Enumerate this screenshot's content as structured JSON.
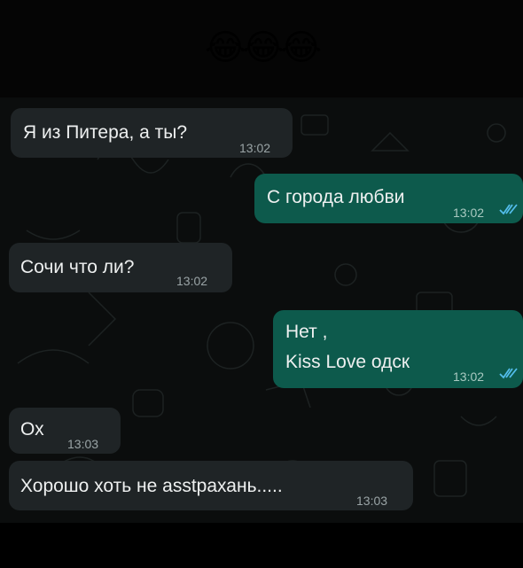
{
  "header": {
    "emojis": "😂😂😂"
  },
  "messages": [
    {
      "direction": "incoming",
      "text": "Я из Питера,  а ты?",
      "time": "13:02"
    },
    {
      "direction": "outgoing",
      "text": "С города любви",
      "time": "13:02",
      "status": "read",
      "status_icon": "double-check-icon"
    },
    {
      "direction": "incoming",
      "text": "Сочи что ли?",
      "time": "13:02"
    },
    {
      "direction": "outgoing",
      "lines": [
        "Нет ,",
        "Kiss Love одск"
      ],
      "time": "13:02",
      "status": "read",
      "status_icon": "double-check-icon"
    },
    {
      "direction": "incoming",
      "text": "Ох",
      "time": "13:03"
    },
    {
      "direction": "incoming",
      "text": "Хорошо хоть не asstрахань.....",
      "time": "13:03"
    }
  ],
  "colors": {
    "incoming_bubble": "#1f2426",
    "outgoing_bubble": "#0d5a4c",
    "read_ticks": "#53bdeb",
    "background": "#0b0d0d"
  }
}
